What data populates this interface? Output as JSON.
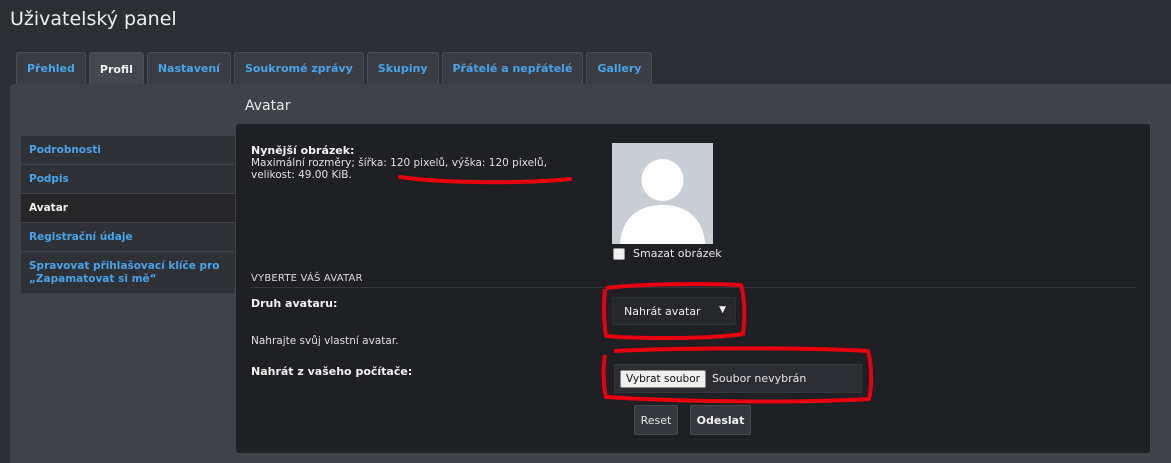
{
  "page": {
    "title": "Uživatelský panel"
  },
  "tabs": [
    {
      "label": "Přehled",
      "active": false
    },
    {
      "label": "Profil",
      "active": true
    },
    {
      "label": "Nastavení",
      "active": false
    },
    {
      "label": "Soukromé zprávy",
      "active": false
    },
    {
      "label": "Skupiny",
      "active": false
    },
    {
      "label": "Přátelé a nepřátelé",
      "active": false
    },
    {
      "label": "Gallery",
      "active": false
    }
  ],
  "section": {
    "title": "Avatar"
  },
  "sidebar": {
    "items": [
      {
        "label": "Podrobnosti"
      },
      {
        "label": "Podpis"
      },
      {
        "label": "Avatar"
      },
      {
        "label": "Registrační údaje"
      },
      {
        "label": "Spravovat přihlašovací klíče pro „Zapamatovat si mě“"
      }
    ]
  },
  "current": {
    "heading": "Nynější obrázek:",
    "line1": "Maximální rozměry; šířka: 120 pixelů, výška: 120 pixelů,",
    "line2": "velikost: 49.00 KiB.",
    "delete_label": "Smazat obrázek"
  },
  "select_section": {
    "heading": "VYBERTE VÁŠ AVATAR",
    "type_label": "Druh avataru:",
    "type_value": "Nahrát avatar",
    "upload_note": "Nahrajte svůj vlastní avatar.",
    "pc_label": "Nahrát z vašeho počítače:",
    "file_button": "Vybrat soubor",
    "file_status": "Soubor nevybrán"
  },
  "buttons": {
    "reset": "Reset",
    "submit": "Odeslat"
  },
  "colors": {
    "link": "#4aa3e8",
    "annotation": "#e8000e",
    "background": "#2b2e33"
  }
}
